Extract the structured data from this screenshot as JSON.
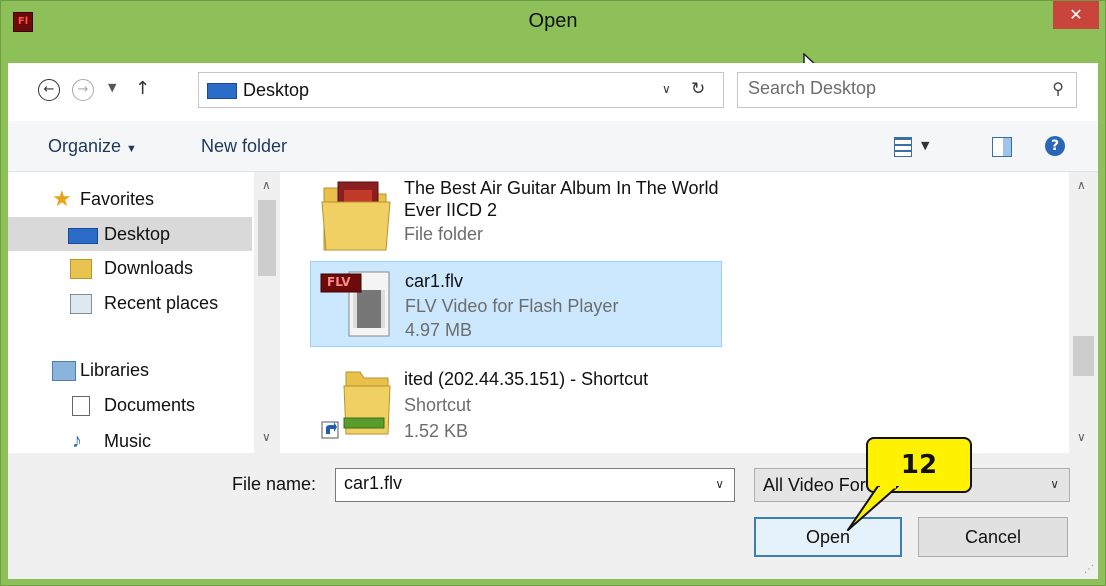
{
  "window": {
    "title": "Open",
    "app_icon_text": "Fl",
    "close_glyph": "✕",
    "accent_color": "#8dc058"
  },
  "address_bar": {
    "back_glyph": "←",
    "forward_glyph": "→",
    "recent_glyph": "▼",
    "up_glyph": "↑",
    "path": "Desktop",
    "path_icon": "desktop-icon",
    "dropdown_glyph": "∨",
    "refresh_glyph": "↻",
    "search_placeholder": "Search Desktop",
    "search_glyph": "⚲"
  },
  "toolbar": {
    "organize_label": "Organize",
    "organize_caret": "▼",
    "new_folder_label": "New folder",
    "view_caret": "▼",
    "help_glyph": "?"
  },
  "nav_pane": {
    "items": [
      {
        "label": "Favorites",
        "icon": "star-icon"
      },
      {
        "label": "Desktop",
        "icon": "desktop-icon",
        "selected": true
      },
      {
        "label": "Downloads",
        "icon": "downloads-icon"
      },
      {
        "label": "Recent places",
        "icon": "recent-places-icon"
      },
      {
        "label": "Libraries",
        "icon": "libraries-icon"
      },
      {
        "label": "Documents",
        "icon": "documents-icon"
      },
      {
        "label": "Music",
        "icon": "music-icon"
      }
    ],
    "scroll_up_glyph": "∧",
    "scroll_down_glyph": "∨"
  },
  "files": [
    {
      "name": "The Best Air Guitar Album In The World Ever IICD 2",
      "type": "File folder",
      "size": "",
      "icon": "album-folder-icon"
    },
    {
      "name": "car1.flv",
      "type": "FLV Video for Flash Player",
      "size": "4.97 MB",
      "icon": "flv-video-icon",
      "selected": true,
      "badge": "FLV"
    },
    {
      "name": "ited (202.44.35.151) - Shortcut",
      "type": "Shortcut",
      "size": "1.52 KB",
      "icon": "network-shortcut-icon"
    }
  ],
  "bottom": {
    "file_name_label": "File name:",
    "file_name_value": "car1.flv",
    "file_name_dropdown_glyph": "∨",
    "file_type_value": "All Video For",
    "file_type_dropdown_glyph": "∨",
    "open_label": "Open",
    "cancel_label": "Cancel",
    "grip_glyph": "⋰"
  },
  "callout": {
    "text": "12",
    "color": "#fff200"
  }
}
